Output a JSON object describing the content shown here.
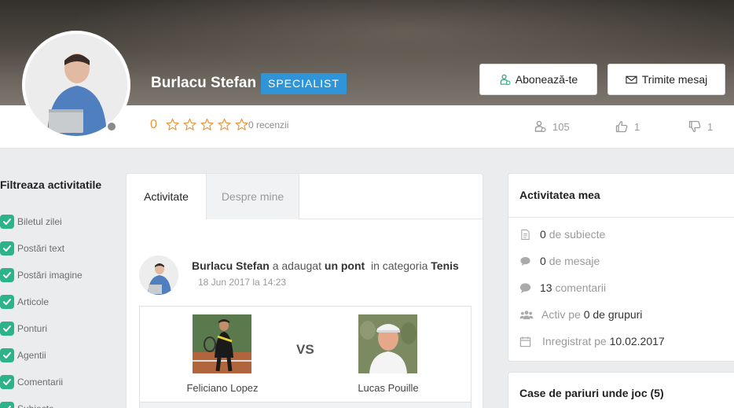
{
  "profile": {
    "name": "Burlacu Stefan",
    "badge": "SPECIALIST",
    "rating": "0",
    "stars_filled": 0,
    "stars_total": 5,
    "reviews": "0 recenzii",
    "subscribe_label": "Abonează-te",
    "message_label": "Trimite mesaj",
    "followers": "105",
    "likes": "1",
    "dislikes": "1",
    "status_color": "#8a8a8a"
  },
  "filters": {
    "title": "Filtreaza activitatile",
    "items": [
      {
        "label": "Biletul zilei",
        "checked": true
      },
      {
        "label": "Postări text",
        "checked": true
      },
      {
        "label": "Postări imagine",
        "checked": true
      },
      {
        "label": "Articole",
        "checked": true
      },
      {
        "label": "Ponturi",
        "checked": true
      },
      {
        "label": "Agentii",
        "checked": true
      },
      {
        "label": "Comentarii",
        "checked": true
      },
      {
        "label": "Subiecte",
        "checked": true
      }
    ]
  },
  "activity": {
    "tabs": [
      {
        "label": "Activitate",
        "active": true
      },
      {
        "label": "Despre mine",
        "active": false
      }
    ],
    "post": {
      "author": "Burlacu Stefan",
      "action": "a adaugat",
      "object": "un pont",
      "category_prefix": "in categoria",
      "category": "Tenis",
      "date": "18 Jun 2017 la 14:23"
    },
    "match": {
      "player1": "Feliciano Lopez",
      "vs": "VS",
      "player2": "Lucas Pouille"
    }
  },
  "my_activity": {
    "title": "Activitatea mea",
    "rows": [
      {
        "icon": "document-icon",
        "value": "0",
        "label": "de subiecte"
      },
      {
        "icon": "chat-bubble-icon",
        "value": "0",
        "label": "de mesaje"
      },
      {
        "icon": "comment-icon",
        "value": "13",
        "label": "comentarii"
      },
      {
        "icon": "group-icon",
        "prefix": "Activ pe",
        "value": "0 de grupuri"
      },
      {
        "icon": "calendar-icon",
        "prefix": "Inregistrat pe",
        "value": "10.02.2017"
      }
    ]
  },
  "betting": {
    "title": "Case de pariuri unde joc (5)"
  },
  "colors": {
    "accent_blue": "#2f95d8",
    "check_green": "#2db389",
    "rating_orange": "#e8963f"
  }
}
